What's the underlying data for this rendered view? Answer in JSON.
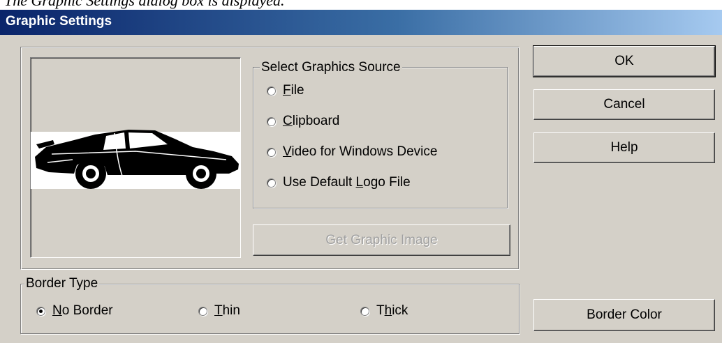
{
  "window": {
    "title": "Graphic Settings"
  },
  "graphics_source": {
    "legend": "Select Graphics Source",
    "options": [
      {
        "accel": "F",
        "rest": "ile",
        "checked": false
      },
      {
        "accel": "C",
        "rest": "lipboard",
        "checked": false
      },
      {
        "accel": "V",
        "rest": "ideo for Windows Device",
        "checked": false
      },
      {
        "pre": "Use Default ",
        "accel": "L",
        "rest": "ogo File",
        "checked": false
      }
    ],
    "get_image_label": "Get Graphic Image"
  },
  "preview": {
    "image": "car-silhouette"
  },
  "border_type": {
    "legend": "Border Type",
    "options": [
      {
        "accel": "N",
        "rest": "o Border",
        "checked": true
      },
      {
        "accel": "T",
        "rest": "hin",
        "checked": false
      },
      {
        "pre": "T",
        "accel": "h",
        "rest": "ick",
        "checked": false
      }
    ]
  },
  "buttons": {
    "ok": "OK",
    "cancel": "Cancel",
    "help": "Help",
    "border_color": "Border Color"
  }
}
